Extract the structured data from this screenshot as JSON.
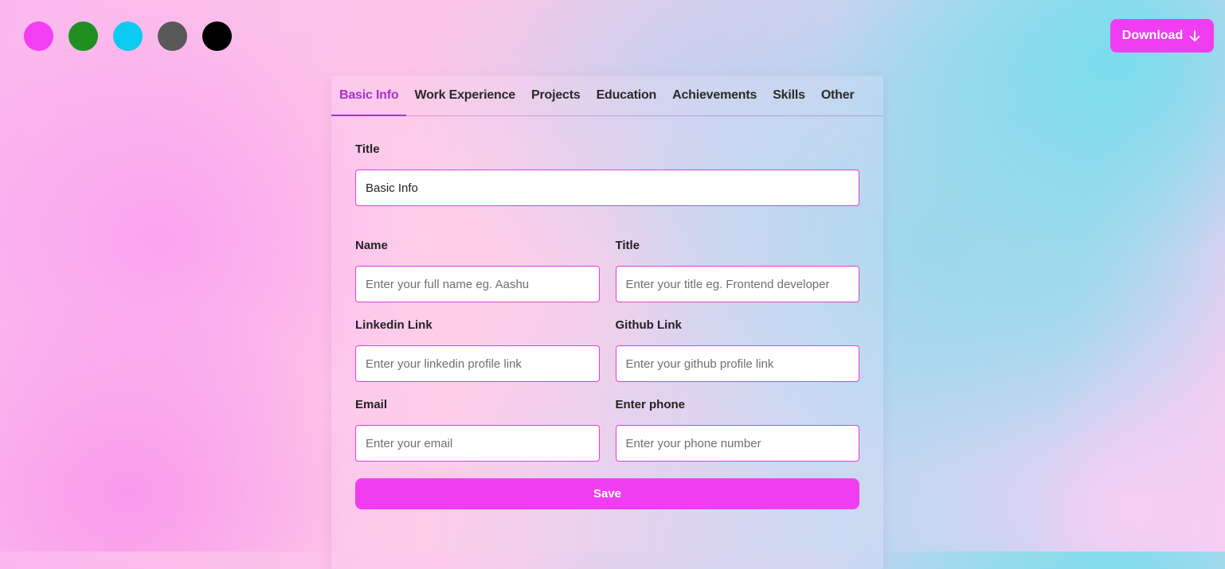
{
  "palette": {
    "swatches": [
      {
        "name": "magenta",
        "color": "#f43ef2"
      },
      {
        "name": "green",
        "color": "#1f8f22"
      },
      {
        "name": "cyan",
        "color": "#0ccaf0"
      },
      {
        "name": "gray",
        "color": "#595959"
      },
      {
        "name": "black",
        "color": "#000000"
      }
    ]
  },
  "header": {
    "download_label": "Download",
    "download_icon": "arrow-down-icon"
  },
  "tabs": [
    {
      "label": "Basic Info",
      "active": true
    },
    {
      "label": "Work Experience",
      "active": false
    },
    {
      "label": "Projects",
      "active": false
    },
    {
      "label": "Education",
      "active": false
    },
    {
      "label": "Achievements",
      "active": false
    },
    {
      "label": "Skills",
      "active": false
    },
    {
      "label": "Other",
      "active": false
    }
  ],
  "form": {
    "section_title_label": "Title",
    "section_title_value": "Basic Info",
    "name_label": "Name",
    "name_placeholder": "Enter your full name eg. Aashu",
    "title_label": "Title",
    "title_placeholder": "Enter your title eg. Frontend developer",
    "linkedin_label": "Linkedin Link",
    "linkedin_placeholder": "Enter your linkedin profile link",
    "github_label": "Github Link",
    "github_placeholder": "Enter your github profile link",
    "email_label": "Email",
    "email_placeholder": "Enter your email",
    "phone_label": "Enter phone",
    "phone_placeholder": "Enter your phone number",
    "save_label": "Save"
  },
  "colors": {
    "accent": "#f13df2",
    "active_tab": "#a434c9",
    "input_border": "#e23fd0"
  }
}
